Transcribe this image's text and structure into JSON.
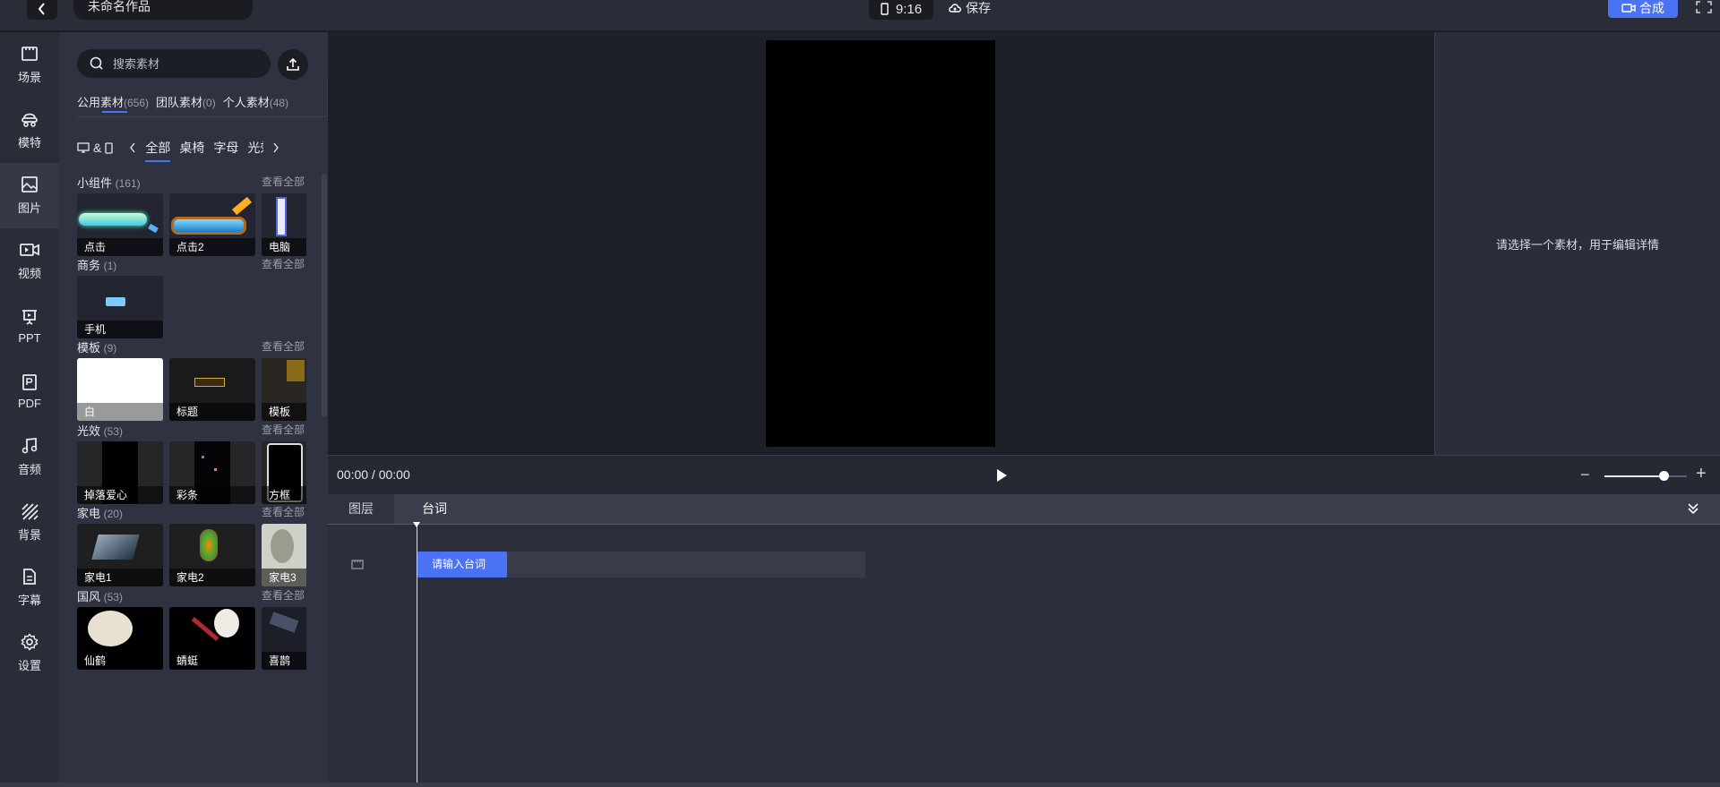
{
  "topbar": {
    "project_title": "未命名作品",
    "ratio": "9:16",
    "save_label": "保存",
    "compose_label": "合成"
  },
  "nav": {
    "items": [
      {
        "label": "场景",
        "icon": "scene-icon"
      },
      {
        "label": "模特",
        "icon": "model-icon"
      },
      {
        "label": "图片",
        "icon": "image-icon"
      },
      {
        "label": "视频",
        "icon": "video-icon"
      },
      {
        "label": "PPT",
        "icon": "ppt-icon"
      },
      {
        "label": "PDF",
        "icon": "pdf-icon"
      },
      {
        "label": "音频",
        "icon": "music-icon"
      },
      {
        "label": "背景",
        "icon": "background-icon"
      },
      {
        "label": "字幕",
        "icon": "subtitle-icon"
      },
      {
        "label": "设置",
        "icon": "settings-icon"
      }
    ]
  },
  "panel": {
    "search_placeholder": "搜索素材",
    "source_tabs": [
      {
        "label": "公用素材",
        "count": "(656)"
      },
      {
        "label": "团队素材",
        "count": "(0)"
      },
      {
        "label": "个人素材",
        "count": "(48)"
      }
    ],
    "device_label": "&",
    "categories": [
      "全部",
      "桌椅",
      "字母",
      "光效"
    ],
    "see_all": "查看全部",
    "sections": [
      {
        "title": "小组件",
        "count": "(161)",
        "items": [
          "点击",
          "点击2",
          "电脑"
        ]
      },
      {
        "title": "商务",
        "count": "(1)",
        "items": [
          "手机"
        ]
      },
      {
        "title": "模板",
        "count": "(9)",
        "items": [
          "白",
          "标题",
          "模板"
        ]
      },
      {
        "title": "光效",
        "count": "(53)",
        "items": [
          "掉落爱心",
          "彩条",
          "方框"
        ]
      },
      {
        "title": "家电",
        "count": "(20)",
        "items": [
          "家电1",
          "家电2",
          "家电3"
        ]
      },
      {
        "title": "国风",
        "count": "(53)",
        "items": [
          "仙鹤",
          "蜻蜓",
          "喜鹊"
        ]
      }
    ]
  },
  "properties": {
    "hint": "请选择一个素材，用于编辑详情"
  },
  "playback": {
    "time": "00:00 / 00:00",
    "zoom_level": 0.72
  },
  "timeline": {
    "tabs": [
      "图层",
      "台词"
    ],
    "clip_label": "请输入台词"
  }
}
